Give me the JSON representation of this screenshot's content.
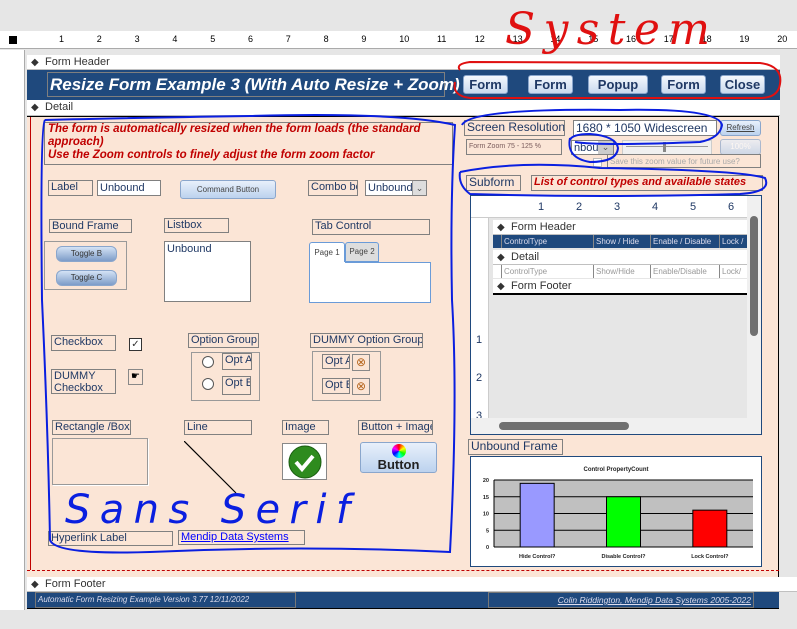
{
  "ruler_numbers": [
    "1",
    "2",
    "3",
    "4",
    "5",
    "6",
    "7",
    "8",
    "9",
    "10",
    "11",
    "12",
    "13",
    "14",
    "15",
    "16",
    "17",
    "18",
    "19",
    "20"
  ],
  "sections": {
    "header": "Form Header",
    "detail": "Detail",
    "footer": "Form Footer"
  },
  "header": {
    "title": "Resize Form Example 3 (With Auto Resize + Zoom)",
    "buttons": [
      "Form",
      "Form",
      "Popup",
      "Form",
      "Close"
    ]
  },
  "detail": {
    "message": "The form is automatically resized when the form loads (the standard approach)\nUse the Zoom controls to finely adjust the form zoom factor",
    "label": "Label",
    "textbox": "Unbound",
    "command_button": "Command Button",
    "combo_label": "Combo bo",
    "combo_value": "Unbound",
    "bound_frame": "Bound Frame",
    "toggle_b": "Toggle B",
    "toggle_c": "Toggle C",
    "listbox_label": "Listbox",
    "listbox_value": "Unbound",
    "tab_label": "Tab Control",
    "tab_pages": [
      "Page 1",
      "Page 2"
    ],
    "checkbox_label": "Checkbox",
    "dummy_checkbox_label": "DUMMY Checkbox",
    "option_group_label": "Option Group",
    "opt_a": "Opt A",
    "opt_b": "Opt B",
    "dummy_option_group_label": "DUMMY Option Group",
    "rectangle_label": "Rectangle /Box",
    "line_label": "Line",
    "image_label": "Image",
    "button_image_label": "Button + Image",
    "button_image_caption": "Button",
    "hyperlink_label": "Hyperlink Label",
    "hyperlink": "Mendip Data Systems",
    "screen_res_label": "Screen Resolution /",
    "screen_res_value": "1680 * 1050 Widescreen",
    "refresh": "Refresh",
    "zoom_label": "Form Zoom  75 - 125 %",
    "zoom_combo": "nbou",
    "zoom_100": "100%",
    "save_zoom": "Save this zoom value for future use?",
    "subform_label": "Subform",
    "subform_title": "List of control types and available states",
    "sub": {
      "ruler": [
        "1",
        "2",
        "3",
        "4",
        "5",
        "6"
      ],
      "vruler": [
        "1",
        "2",
        "3"
      ],
      "header": "Form Header",
      "detail": "Detail",
      "footer": "Form Footer",
      "header_cols": [
        "ControlType",
        "Show / Hide",
        "Enable / Disable",
        "Lock /"
      ],
      "detail_cols": [
        "ControlType",
        "Show/Hide",
        "Enable/Disable",
        "Lock/"
      ]
    },
    "unbound_frame": "Unbound Frame"
  },
  "footer": {
    "left": "Automatic Form Resizing Example  Version 3.77  12/11/2022",
    "right": "Colin Riddington, Mendip Data Systems 2005-2022"
  },
  "annotations": {
    "top": "System",
    "bottom": "Sans Serif"
  },
  "colors": {
    "band": "#1f497d",
    "detail_bg": "#fbe5d6",
    "red_text": "#c00000",
    "ink_blue": "#0a1fe0",
    "ink_red": "#e01010"
  },
  "chart_data": {
    "type": "bar",
    "title": "Control PropertyCount",
    "categories": [
      "Hide Control?",
      "Disable Control?",
      "Lock Control?"
    ],
    "values": [
      19,
      15,
      11
    ],
    "colors": [
      "#9999ff",
      "#00ff00",
      "#ff0000"
    ],
    "ylim": [
      0,
      20
    ],
    "yticks": [
      "0",
      "5",
      "10",
      "15",
      "20"
    ],
    "grid": true,
    "xlabel": "",
    "ylabel": ""
  }
}
